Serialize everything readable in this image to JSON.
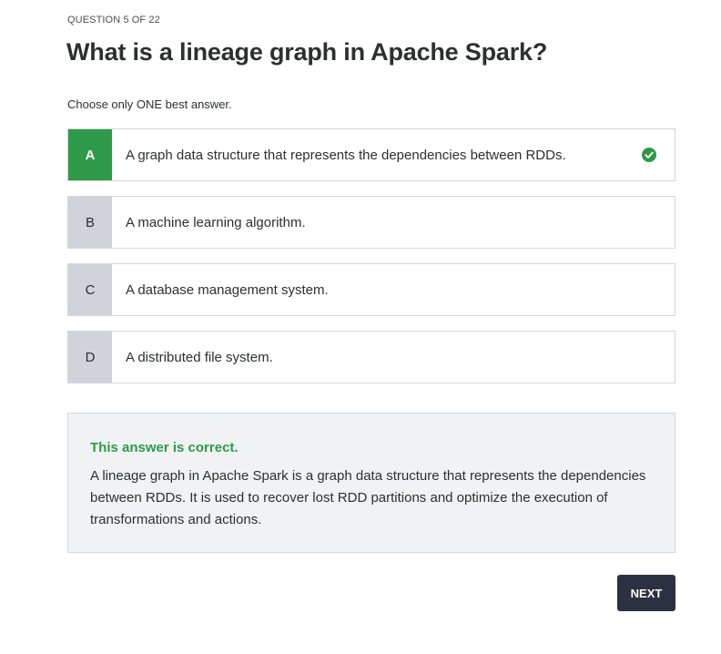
{
  "header": {
    "progress": "QUESTION 5 OF 22",
    "question": "What is a lineage graph in Apache Spark?",
    "instruction": "Choose only ONE best answer."
  },
  "options": [
    {
      "letter": "A",
      "text": "A graph data structure that represents the dependencies between RDDs.",
      "state": "correct"
    },
    {
      "letter": "B",
      "text": "A machine learning algorithm.",
      "state": "default"
    },
    {
      "letter": "C",
      "text": "A database management system.",
      "state": "default"
    },
    {
      "letter": "D",
      "text": "A distributed file system.",
      "state": "default"
    }
  ],
  "feedback": {
    "status": "This answer is correct.",
    "explanation": "A lineage graph in Apache Spark is a graph data structure that represents the dependencies between RDDs. It is used to recover lost RDD partitions and optimize the execution of transformations and actions."
  },
  "actions": {
    "next_label": "NEXT"
  },
  "colors": {
    "correct": "#2e9a48",
    "letter_bg": "#d1d3db",
    "feedback_bg": "#f1f2f4",
    "button_bg": "#2d2f43"
  },
  "icons": {
    "correct_marker": "check-circle-icon"
  }
}
